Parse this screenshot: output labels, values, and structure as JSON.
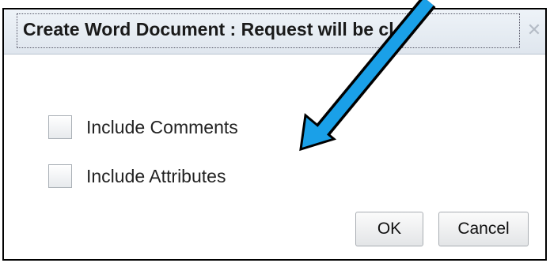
{
  "dialog": {
    "title": "Create Word Document : Request will be cl...",
    "close_icon": "close-icon",
    "options": [
      {
        "label": "Include Comments",
        "checked": false
      },
      {
        "label": "Include Attributes",
        "checked": false
      }
    ],
    "ok_label": "OK",
    "cancel_label": "Cancel"
  },
  "annotation": {
    "arrow_color": "#1aa0e8"
  }
}
